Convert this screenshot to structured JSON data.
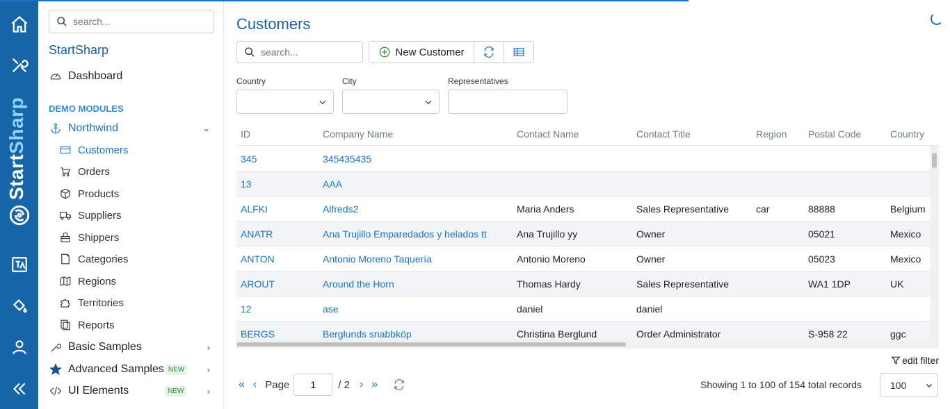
{
  "brand": {
    "part1": "Start",
    "part2": "Sharp"
  },
  "sidebar": {
    "search_placeholder": "search...",
    "title": "StartSharp",
    "dashboard": "Dashboard",
    "section": "DEMO MODULES",
    "northwind": "Northwind",
    "items": [
      {
        "label": "Customers",
        "icon": "customers-icon"
      },
      {
        "label": "Orders",
        "icon": "cart-icon"
      },
      {
        "label": "Products",
        "icon": "box-icon"
      },
      {
        "label": "Suppliers",
        "icon": "truck-icon"
      },
      {
        "label": "Shippers",
        "icon": "bag-icon"
      },
      {
        "label": "Categories",
        "icon": "folder-icon"
      },
      {
        "label": "Regions",
        "icon": "map-icon"
      },
      {
        "label": "Territories",
        "icon": "puzzle-icon"
      },
      {
        "label": "Reports",
        "icon": "reports-icon"
      }
    ],
    "basic": "Basic Samples",
    "advanced": "Advanced Samples",
    "ui": "UI Elements",
    "new_badge": "NEW"
  },
  "main": {
    "title": "Customers",
    "search_placeholder": "search...",
    "new_button": "New Customer",
    "filters": {
      "country": "Country",
      "city": "City",
      "representatives": "Representatives"
    },
    "columns": [
      "ID",
      "Company Name",
      "Contact Name",
      "Contact Title",
      "Region",
      "Postal Code",
      "Country"
    ],
    "rows": [
      [
        "345",
        "345435435",
        "",
        "",
        "",
        "",
        ""
      ],
      [
        "13",
        "AAA",
        "",
        "",
        "",
        "",
        ""
      ],
      [
        "ALFKI",
        "Alfreds2",
        "Maria Anders",
        "Sales Representative",
        "car",
        "88888",
        "Belgium"
      ],
      [
        "ANATR",
        "Ana Trujillo Emparedados y helados tt",
        "Ana Trujillo yy",
        "Owner",
        "",
        "05021",
        "Mexico"
      ],
      [
        "ANTON",
        "Antonio Moreno Taquería",
        "Antonio Moreno",
        "Owner",
        "",
        "05023",
        "Mexico"
      ],
      [
        "AROUT",
        "Around the Horn",
        "Thomas Hardy",
        "Sales Representative",
        "",
        "WA1 1DP",
        "UK"
      ],
      [
        "12",
        "ase",
        "daniel",
        "daniel",
        "",
        "",
        ""
      ],
      [
        "BERGS",
        "Berglunds snabbköp",
        "Christina Berglund",
        "Order Administrator",
        "",
        "S-958 22",
        "ggc"
      ]
    ],
    "edit_filter": "edit filter",
    "pager": {
      "page_label": "Page",
      "page_value": "1",
      "total": "/ 2",
      "showing": "Showing 1 to 100 of 154 total records",
      "page_size": "100"
    }
  },
  "colors": {
    "rail": "#1565a8",
    "accent": "#1a73c9",
    "title": "#1a5fa8"
  }
}
